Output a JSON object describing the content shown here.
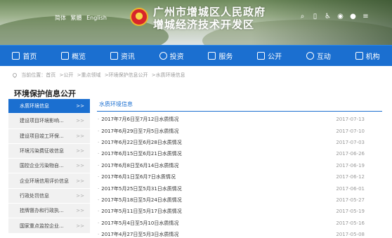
{
  "header": {
    "languages": [
      "简体",
      "繁體",
      "English"
    ],
    "title_line1": "广州市增城区人民政府",
    "title_line2": "增城经济技术开发区",
    "tools": [
      {
        "icon": "search-icon",
        "glyph": "⌕"
      },
      {
        "icon": "mobile-icon",
        "glyph": "▯"
      },
      {
        "icon": "accessibility-icon",
        "glyph": "♿"
      },
      {
        "icon": "weibo-icon",
        "glyph": "◉"
      },
      {
        "icon": "wechat-icon",
        "glyph": "●"
      },
      {
        "icon": "more-icon",
        "glyph": "≡"
      }
    ]
  },
  "nav": {
    "items": [
      "首页",
      "概览",
      "资讯",
      "投资",
      "服务",
      "公开",
      "互动",
      "机构"
    ]
  },
  "breadcrumb": {
    "items": [
      "当前位置：首页",
      ">公开",
      ">重点领域",
      ">环境保护信息公开",
      ">水质环境信息"
    ]
  },
  "sidebar": {
    "title": "环境保护信息公开",
    "items": [
      {
        "label": "水质环境信息",
        "active": true
      },
      {
        "label": "建设项目环境影响..."
      },
      {
        "label": "建设项目竣工环保..."
      },
      {
        "label": "环境污染费征收信息"
      },
      {
        "label": "国控企业污染物自..."
      },
      {
        "label": "企业环境信用评价信息"
      },
      {
        "label": "行政处罚信息"
      },
      {
        "label": "挂牌督办和行政执..."
      },
      {
        "label": "国家重点监控企业..."
      }
    ],
    "arrow": ">>"
  },
  "main": {
    "title": "水质环境信息",
    "rows": [
      {
        "title": "2017年7月6日至7月12日水质情况",
        "date": "2017-07-13"
      },
      {
        "title": "2017年6月29日至7月5日水质情况",
        "date": "2017-07-10"
      },
      {
        "title": "2017年6月22日至6月28日水质情况",
        "date": "2017-07-03"
      },
      {
        "title": "2017年6月15日至6月21日水质情况",
        "date": "2017-06-26"
      },
      {
        "title": "2017年6月8日至6月14日水质情况",
        "date": "2017-06-19"
      },
      {
        "title": "2017年6月1日至6月7日水质情况",
        "date": "2017-06-12"
      },
      {
        "title": "2017年5月25日至5月31日水质情况",
        "date": "2017-06-01"
      },
      {
        "title": "2017年5月18日至5月24日水质情况",
        "date": "2017-05-27"
      },
      {
        "title": "2017年5月11日至5月17日水质情况",
        "date": "2017-05-19"
      },
      {
        "title": "2017年5月4日至5月10日水质情况",
        "date": "2017-05-16"
      },
      {
        "title": "2017年4月27日至5月3日水质情况",
        "date": "2017-05-08"
      }
    ]
  },
  "colors": {
    "accent": "#1b6fd0"
  }
}
